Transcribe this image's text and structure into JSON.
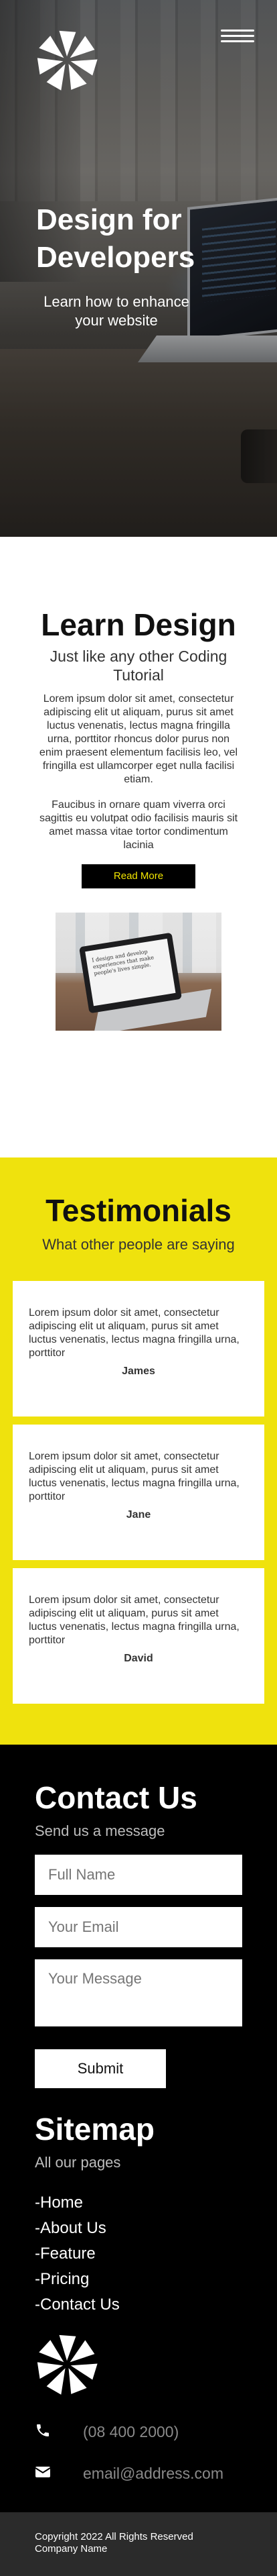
{
  "hero": {
    "title": "Design for Developers",
    "subtitle": "Learn how to enhance your website"
  },
  "nav": {
    "menu_icon": "hamburger-menu-icon",
    "logo_icon": "pinwheel-logo-icon"
  },
  "learn": {
    "title": "Learn Design",
    "tagline": "Just like any other Coding Tutorial",
    "paragraph1": "Lorem ipsum dolor sit amet, consectetur adipiscing elit ut aliquam, purus sit amet luctus venenatis, lectus magna fringilla urna, porttitor rhoncus dolor purus non enim praesent elementum facilisis leo, vel fringilla est ullamcorper eget nulla facilisi etiam.",
    "paragraph2": "Faucibus in ornare quam viverra orci sagittis eu volutpat odio facilisis mauris sit amet massa vitae tortor condimentum lacinia",
    "button": "Read More",
    "photo_screen_text": "I design and develop experiences that make people's lives simple."
  },
  "testimonials": {
    "title": "Testimonials",
    "tagline": "What other people are saying",
    "items": [
      {
        "text": "Lorem ipsum dolor sit amet, consectetur adipiscing elit ut aliquam, purus sit amet luctus venenatis, lectus magna fringilla urna, porttitor",
        "name": "James"
      },
      {
        "text": "Lorem ipsum dolor sit amet, consectetur adipiscing elit ut aliquam, purus sit amet luctus venenatis, lectus magna fringilla urna, porttitor",
        "name": "Jane"
      },
      {
        "text": "Lorem ipsum dolor sit amet, consectetur adipiscing elit ut aliquam, purus sit amet luctus venenatis, lectus magna fringilla urna, porttitor",
        "name": "David"
      }
    ]
  },
  "contact": {
    "title": "Contact Us",
    "tagline": "Send us a message",
    "name_placeholder": "Full Name",
    "email_placeholder": "Your Email",
    "message_placeholder": "Your Message",
    "submit": "Submit"
  },
  "sitemap": {
    "title": "Sitemap",
    "tagline": "All our pages",
    "links": [
      "-Home",
      "-About Us",
      "-Feature",
      "-Pricing",
      "-Contact Us"
    ]
  },
  "info": {
    "phone": "(08 400 2000)",
    "email": "email@address.com",
    "phone_icon": "phone-icon",
    "email_icon": "envelope-icon"
  },
  "footer": {
    "line1": "Copyright 2022 All Rights Reserved",
    "line2": "Company Name"
  },
  "colors": {
    "accent_yellow": "#efe20d",
    "button_text_yellow": "#f3e600",
    "dark": "#000000",
    "footer_bar": "#2b2b2b"
  }
}
